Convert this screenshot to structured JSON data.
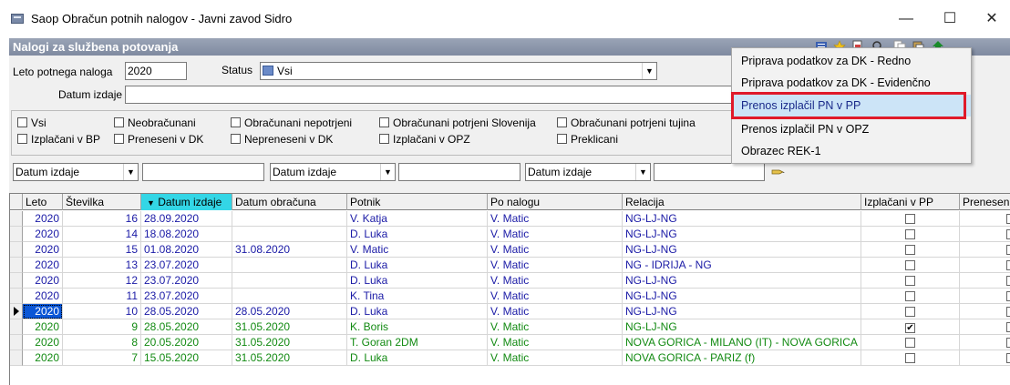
{
  "window": {
    "title": "Saop Obračun potnih nalogov - Javni zavod Sidro",
    "minimize": "—",
    "maximize": "☐",
    "close": "✕"
  },
  "panel": {
    "header": "Nalogi za službena potovanja"
  },
  "filters": {
    "year_label": "Leto potnega naloga",
    "year_value": "2020",
    "status_label": "Status",
    "status_value": "Vsi",
    "date_label": "Datum izdaje",
    "date_value": ""
  },
  "checkboxes": {
    "row1": [
      "Vsi",
      "Neobračunani",
      "Obračunani nepotrjeni",
      "Obračunani potrjeni Slovenija",
      "Obračunani potrjeni tujina"
    ],
    "row2": [
      "Izplačani v BP",
      "Preneseni v DK",
      "Nepreneseni v DK",
      "Izplačani v OPZ",
      "Preklicani"
    ]
  },
  "search": [
    {
      "field": "Datum izdaje",
      "value": ""
    },
    {
      "field": "Datum izdaje",
      "value": ""
    },
    {
      "field": "Datum izdaje",
      "value": ""
    }
  ],
  "table": {
    "columns": [
      "Leto",
      "Številka",
      "Datum izdaje",
      "Datum obračuna",
      "Potnik",
      "Po nalogu",
      "Relacija",
      "Izplačani v PP",
      "Preneseni v DK"
    ],
    "sorted_column": "Datum izdaje",
    "sort_glyph": "▼",
    "rows": [
      {
        "leto": "2020",
        "stevilka": "16",
        "datum_izdaje": "28.09.2020",
        "datum_obracuna": "",
        "potnik": "V. Katja",
        "po_nalogu": "V. Matic",
        "relacija": "NG-LJ-NG",
        "izplacani_pp": false,
        "color": "blue"
      },
      {
        "leto": "2020",
        "stevilka": "14",
        "datum_izdaje": "18.08.2020",
        "datum_obracuna": "",
        "potnik": "D. Luka",
        "po_nalogu": "V. Matic",
        "relacija": "NG-LJ-NG",
        "izplacani_pp": false,
        "color": "blue"
      },
      {
        "leto": "2020",
        "stevilka": "15",
        "datum_izdaje": "01.08.2020",
        "datum_obracuna": "31.08.2020",
        "potnik": "V. Matic",
        "po_nalogu": "V. Matic",
        "relacija": "NG-LJ-NG",
        "izplacani_pp": false,
        "color": "blue"
      },
      {
        "leto": "2020",
        "stevilka": "13",
        "datum_izdaje": "23.07.2020",
        "datum_obracuna": "",
        "potnik": "D. Luka",
        "po_nalogu": "V. Matic",
        "relacija": "NG - IDRIJA - NG",
        "izplacani_pp": false,
        "color": "blue"
      },
      {
        "leto": "2020",
        "stevilka": "12",
        "datum_izdaje": "23.07.2020",
        "datum_obracuna": "",
        "potnik": "D. Luka",
        "po_nalogu": "V. Matic",
        "relacija": "NG-LJ-NG",
        "izplacani_pp": false,
        "color": "blue"
      },
      {
        "leto": "2020",
        "stevilka": "11",
        "datum_izdaje": "23.07.2020",
        "datum_obracuna": "",
        "potnik": "K. Tina",
        "po_nalogu": "V. Matic",
        "relacija": "NG-LJ-NG",
        "izplacani_pp": false,
        "color": "blue"
      },
      {
        "leto": "2020",
        "stevilka": "10",
        "datum_izdaje": "28.05.2020",
        "datum_obracuna": "28.05.2020",
        "potnik": "D. Luka",
        "po_nalogu": "V. Matic",
        "relacija": "NG-LJ-NG",
        "izplacani_pp": false,
        "color": "blue",
        "current": true
      },
      {
        "leto": "2020",
        "stevilka": "9",
        "datum_izdaje": "28.05.2020",
        "datum_obracuna": "31.05.2020",
        "potnik": "K. Boris",
        "po_nalogu": "V. Matic",
        "relacija": "NG-LJ-NG",
        "izplacani_pp": true,
        "color": "green"
      },
      {
        "leto": "2020",
        "stevilka": "8",
        "datum_izdaje": "20.05.2020",
        "datum_obracuna": "31.05.2020",
        "potnik": "T. Goran 2DM",
        "po_nalogu": "V. Matic",
        "relacija": "NOVA GORICA - MILANO (IT) - NOVA GORICA",
        "izplacani_pp": false,
        "color": "green"
      },
      {
        "leto": "2020",
        "stevilka": "7",
        "datum_izdaje": "15.05.2020",
        "datum_obracuna": "31.05.2020",
        "potnik": "D. Luka",
        "po_nalogu": "V. Matic",
        "relacija": "NOVA GORICA - PARIZ (f)",
        "izplacani_pp": false,
        "color": "green"
      }
    ]
  },
  "context_menu": {
    "items": [
      "Priprava podatkov za DK - Redno",
      "Priprava podatkov za DK - Evidenčno",
      "Prenos izplačil PN v PP",
      "Prenos izplačil PN v OPZ",
      "Obrazec REK-1"
    ],
    "highlighted": "Prenos izplačil PN v PP"
  },
  "colors": {
    "highlight_box": "#e01a2a",
    "blue_row_text": "#1a1aa6",
    "green_row_text": "#128a12",
    "sort_header": "#33d6e6"
  }
}
